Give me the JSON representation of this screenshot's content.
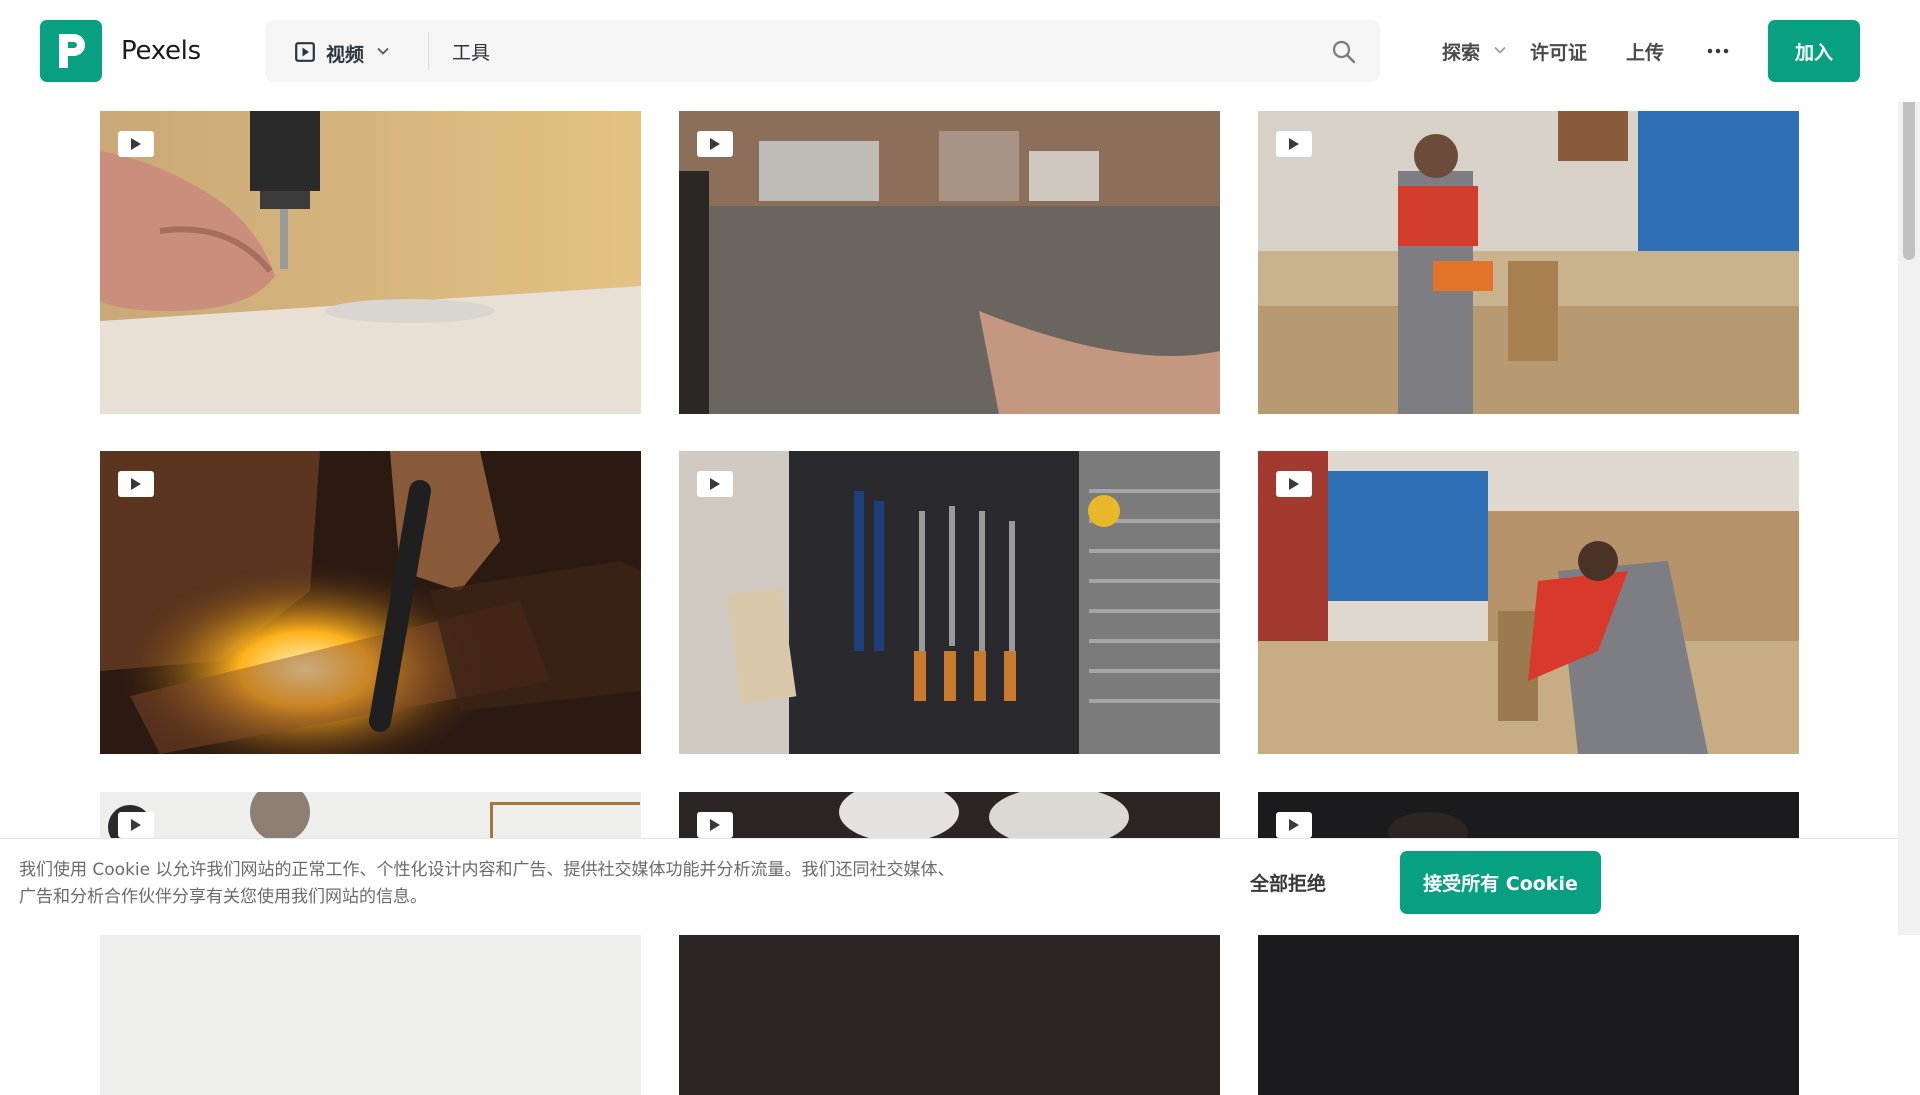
{
  "header": {
    "brand": "Pexels",
    "search_type": "视频",
    "search_value": "工具",
    "nav_explore": "探索",
    "nav_license": "许可证",
    "nav_upload": "上传",
    "more_icon": "more-dots-icon",
    "join_label": "加入"
  },
  "colors": {
    "accent": "#07a081",
    "header_bg": "#ffffff",
    "search_bg": "#f5f5f5"
  },
  "videos": [
    {
      "subject": "hand drilling screw into wood",
      "badge_icon": "play-icon"
    },
    {
      "subject": "blurred workshop floor",
      "badge_icon": "play-icon"
    },
    {
      "subject": "carpenter using power sander",
      "badge_icon": "play-icon"
    },
    {
      "subject": "glassblower heating glass",
      "badge_icon": "play-icon"
    },
    {
      "subject": "tools hanging on pegboard",
      "badge_icon": "play-icon"
    },
    {
      "subject": "carpenter working at bench",
      "badge_icon": "play-icon"
    },
    {
      "subject": "dried flowers on table",
      "badge_icon": "play-icon"
    },
    {
      "subject": "people in dark workshop",
      "badge_icon": "play-icon"
    },
    {
      "subject": "dark scene",
      "badge_icon": "play-icon"
    }
  ],
  "cookie": {
    "text": "我们使用 Cookie 以允许我们网站的正常工作、个性化设计内容和广告、提供社交媒体功能并分析流量。我们还同社交媒体、广告和分析合作伙伴分享有关您使用我们网站的信息。",
    "reject_label": "全部拒绝",
    "accept_label": "接受所有 Cookie"
  }
}
